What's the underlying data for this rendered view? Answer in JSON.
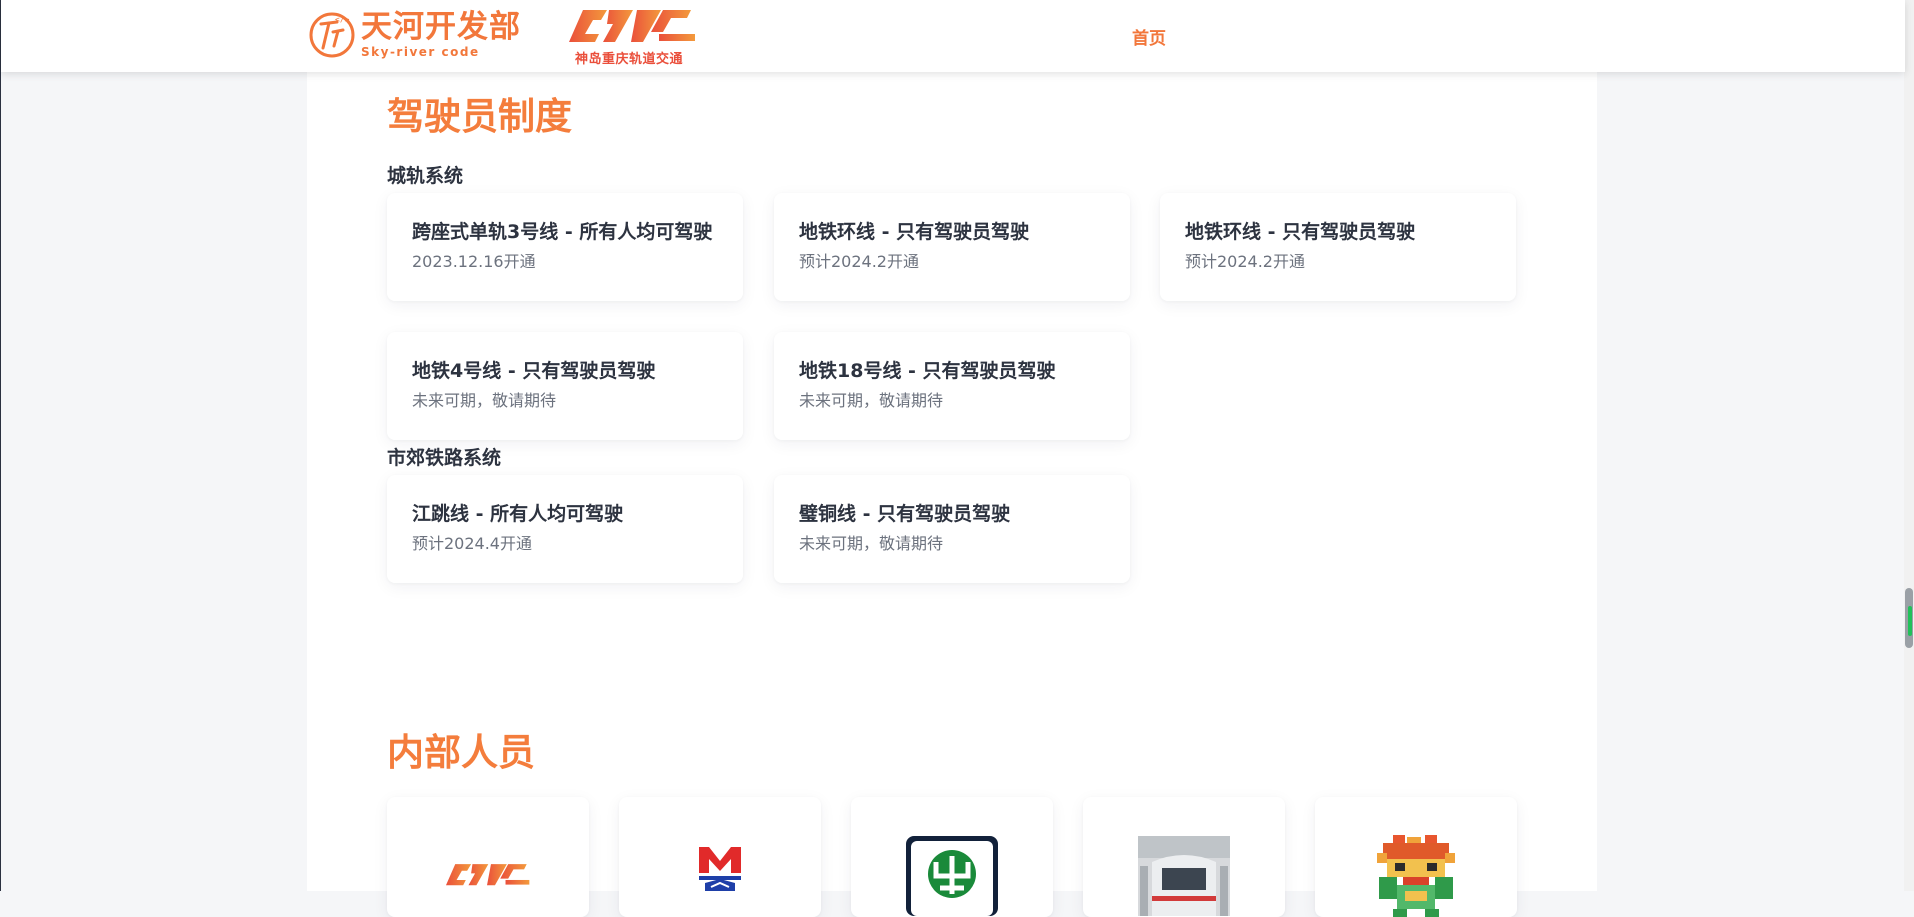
{
  "header": {
    "brand_name": "天河开发部",
    "brand_sub": "Sky-river code",
    "partner_caption": "神岛重庆轨道交通",
    "nav_home": "首页"
  },
  "sections": {
    "driver_policy_title": "驾驶员制度",
    "staff_title": "内部人员"
  },
  "groups": {
    "urban_rail": {
      "label": "城轨系统",
      "cards": [
        {
          "title": "跨座式单轨3号线 - 所有人均可驾驶",
          "sub": "2023.12.16开通"
        },
        {
          "title": "地铁环线 - 只有驾驶员驾驶",
          "sub": "预计2024.2开通"
        },
        {
          "title": "地铁环线 - 只有驾驶员驾驶",
          "sub": "预计2024.2开通"
        },
        {
          "title": "地铁4号线 - 只有驾驶员驾驶",
          "sub": "未来可期，敬请期待"
        },
        {
          "title": "地铁18号线 - 只有驾驶员驾驶",
          "sub": "未来可期，敬请期待"
        }
      ]
    },
    "suburban_rail": {
      "label": "市郊铁路系统",
      "cards": [
        {
          "title": "江跳线 - 所有人均可驾驶",
          "sub": "预计2024.4开通"
        },
        {
          "title": "璧铜线 - 只有驾驶员驾驶",
          "sub": "未来可期，敬请期待"
        }
      ]
    }
  },
  "colors": {
    "accent": "#f47d3c",
    "heading_text": "#2d3340",
    "muted_text": "#6c727e",
    "metro_red": "#e12a2a",
    "metro_blue": "#1e3fa8",
    "rail_green": "#1a8a3a"
  },
  "staff_logos": [
    "cqrt-logo-icon",
    "metro-m-logo-icon",
    "china-railway-logo-icon",
    "train-photo-icon",
    "pixel-character-icon"
  ]
}
